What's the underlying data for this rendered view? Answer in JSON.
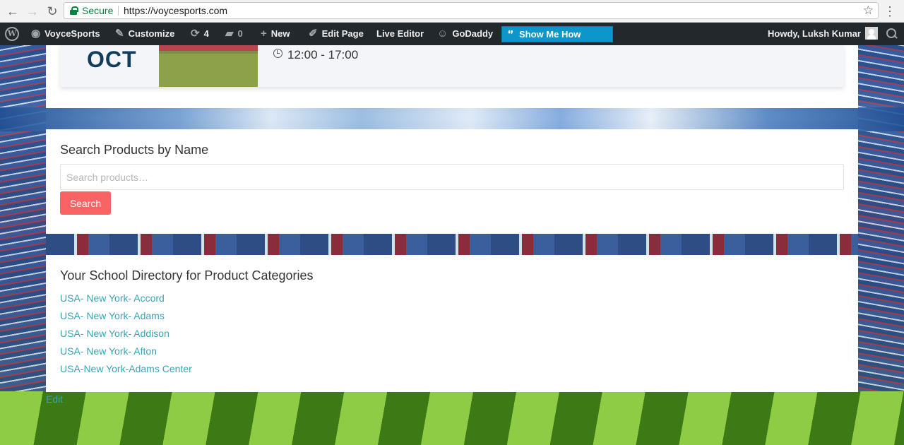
{
  "browser": {
    "secure_label": "Secure",
    "url": "https://voycesports.com"
  },
  "adminbar": {
    "site_name": "VoyceSports",
    "customize": "Customize",
    "updates_count": "4",
    "comments_count": "0",
    "new": "New",
    "edit_page": "Edit Page",
    "live_editor": "Live Editor",
    "godaddy": "GoDaddy",
    "show_me_how": "Show Me How",
    "howdy": "Howdy, Luksh Kumar"
  },
  "event": {
    "month": "OCT",
    "time": "12:00 - 17:00"
  },
  "search": {
    "title": "Search Products by Name",
    "placeholder": "Search products…",
    "button": "Search"
  },
  "directory": {
    "title": "Your School Directory for Product Categories",
    "items": [
      "USA- New York- Accord",
      "USA- New York- Adams",
      "USA- New York- Addison",
      "USA- New York- Afton",
      "USA-New York-Adams Center"
    ]
  },
  "edit_link": "Edit"
}
